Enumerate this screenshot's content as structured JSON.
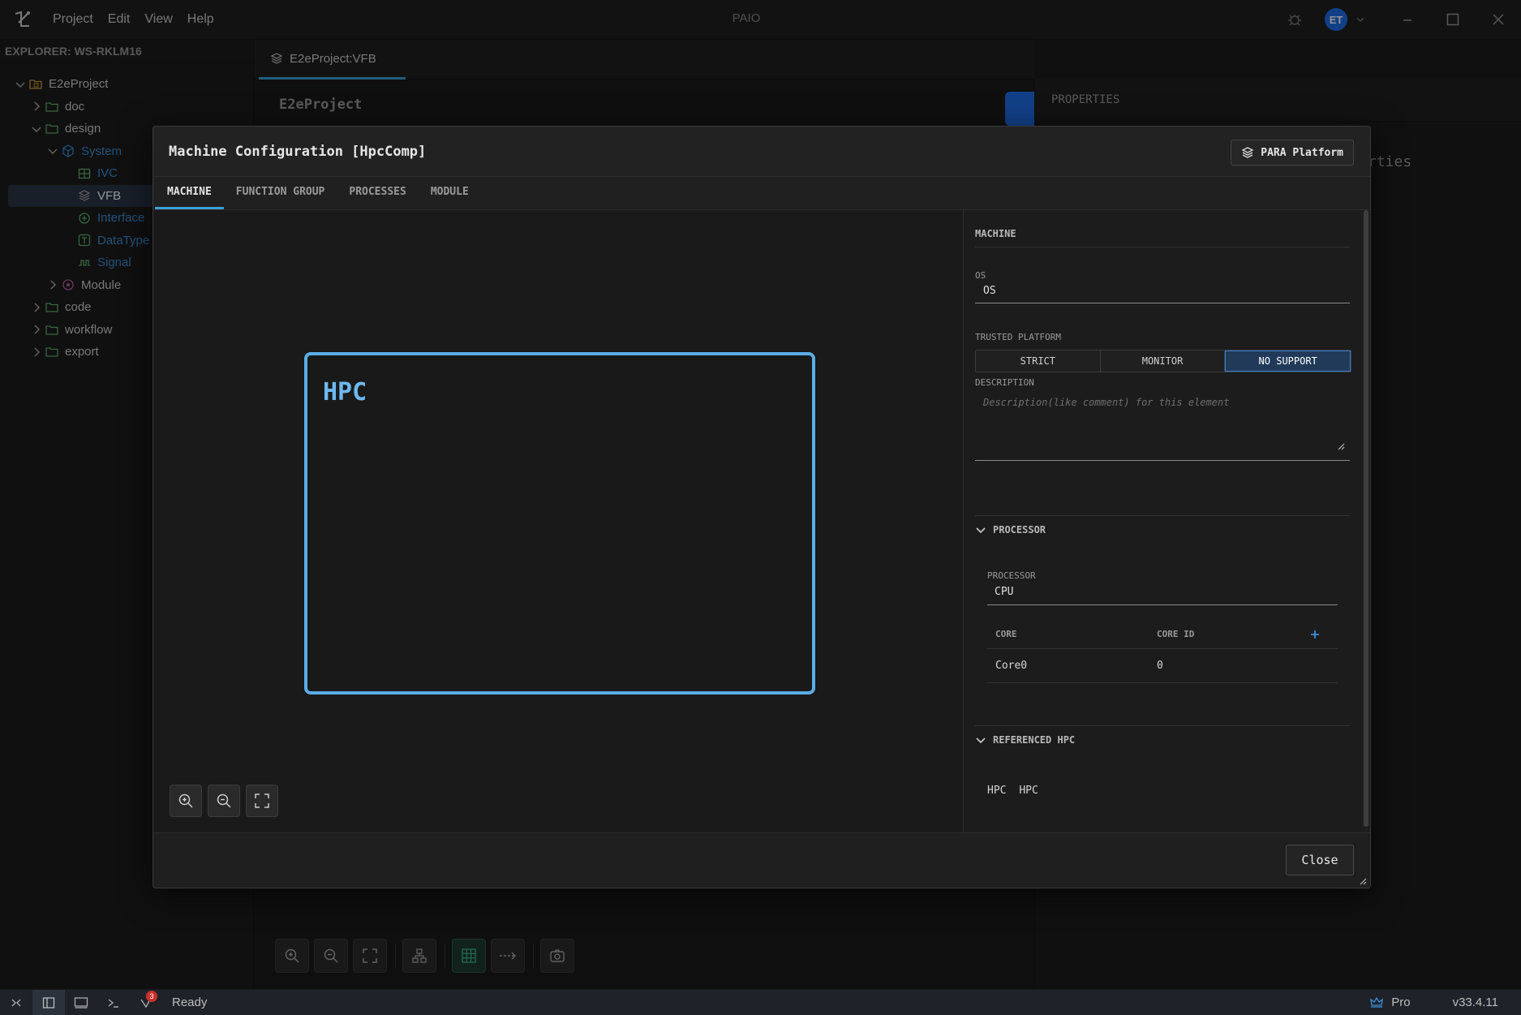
{
  "window": {
    "title": "PAIO",
    "menu": [
      "Project",
      "Edit",
      "View",
      "Help"
    ],
    "user_initials": "ET"
  },
  "explorer": {
    "header": "EXPLORER: WS-RKLM16",
    "items": [
      {
        "label": "E2eProject",
        "depth": 0,
        "expanded": true,
        "icon": "project-folder-icon"
      },
      {
        "label": "doc",
        "depth": 1,
        "expanded": false,
        "icon": "folder-icon"
      },
      {
        "label": "design",
        "depth": 1,
        "expanded": true,
        "icon": "folder-icon"
      },
      {
        "label": "System",
        "depth": 2,
        "expanded": true,
        "icon": "cube-icon"
      },
      {
        "label": "IVC",
        "depth": 3,
        "icon": "grid-icon"
      },
      {
        "label": "VFB",
        "depth": 3,
        "icon": "layers-icon",
        "selected": true
      },
      {
        "label": "Interface",
        "depth": 3,
        "icon": "interface-icon"
      },
      {
        "label": "DataType",
        "depth": 3,
        "icon": "datatype-icon"
      },
      {
        "label": "Signal",
        "depth": 3,
        "icon": "signal-icon"
      },
      {
        "label": "Module",
        "depth": 2,
        "expanded": false,
        "icon": "module-icon"
      },
      {
        "label": "code",
        "depth": 1,
        "expanded": false,
        "icon": "folder-icon"
      },
      {
        "label": "workflow",
        "depth": 1,
        "expanded": false,
        "icon": "folder-icon"
      },
      {
        "label": "export",
        "depth": 1,
        "expanded": false,
        "icon": "folder-icon"
      }
    ]
  },
  "editor": {
    "tab_label": "E2eProject:VFB",
    "breadcrumb": "E2eProject"
  },
  "properties": {
    "title": "PROPERTIES",
    "background_text": "rties"
  },
  "dialog": {
    "title": "Machine Configuration [HpcComp]",
    "platform_button": "PARA Platform",
    "tabs": [
      "MACHINE",
      "FUNCTION GROUP",
      "PROCESSES",
      "MODULE"
    ],
    "active_tab": "MACHINE",
    "canvas": {
      "node_label": "HPC"
    },
    "machine": {
      "section_title": "MACHINE",
      "os_label": "OS",
      "os_value": "OS",
      "trusted_platform_label": "TRUSTED PLATFORM",
      "trusted_platform_options": [
        "STRICT",
        "MONITOR",
        "NO SUPPORT"
      ],
      "trusted_platform_selected": "NO SUPPORT",
      "description_label": "DESCRIPTION",
      "description_placeholder": "Description(like comment) for this element"
    },
    "processor": {
      "section_title": "PROCESSOR",
      "label": "PROCESSOR",
      "value": "CPU",
      "columns": [
        "CORE",
        "CORE ID"
      ],
      "rows": [
        {
          "core": "Core0",
          "core_id": "0"
        }
      ]
    },
    "referenced_hpc": {
      "section_title": "REFERENCED HPC",
      "items": [
        {
          "type": "HPC",
          "name": "HPC"
        }
      ]
    },
    "close_label": "Close"
  },
  "statusbar": {
    "status": "Ready",
    "badge_count": "3",
    "plan": "Pro",
    "version": "v33.4.11"
  }
}
